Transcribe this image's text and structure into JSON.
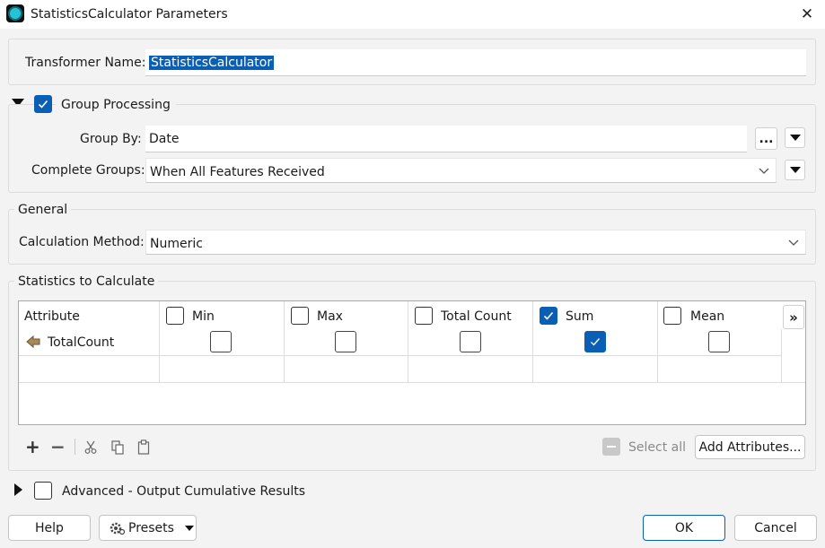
{
  "window": {
    "title": "StatisticsCalculator Parameters"
  },
  "transformer": {
    "label": "Transformer Name:",
    "value": "StatisticsCalculator"
  },
  "group_processing": {
    "label": "Group Processing",
    "checked": true,
    "group_by": {
      "label": "Group By:",
      "value": "Date",
      "browse_label": "..."
    },
    "complete_groups": {
      "label": "Complete Groups:",
      "value": "When All Features Received"
    }
  },
  "general": {
    "label": "General",
    "calc_method": {
      "label": "Calculation Method:",
      "value": "Numeric"
    }
  },
  "stats": {
    "label": "Statistics to Calculate",
    "attribute_header": "Attribute",
    "more_label": "»",
    "columns": [
      {
        "label": "Min",
        "header_checked": false,
        "row_checked": false
      },
      {
        "label": "Max",
        "header_checked": false,
        "row_checked": false
      },
      {
        "label": "Total Count",
        "header_checked": false,
        "row_checked": false
      },
      {
        "label": "Sum",
        "header_checked": true,
        "row_checked": true
      },
      {
        "label": "Mean",
        "header_checked": false,
        "row_checked": false
      }
    ],
    "rows": [
      {
        "attribute": "TotalCount"
      }
    ],
    "toolbar": {
      "select_all_label": "Select all",
      "add_attributes_label": "Add Attributes..."
    }
  },
  "advanced": {
    "label": "Advanced - Output Cumulative Results",
    "checked": false
  },
  "footer": {
    "help_label": "Help",
    "presets_label": "Presets",
    "ok_label": "OK",
    "cancel_label": "Cancel"
  },
  "colors": {
    "accent": "#0a5fb4",
    "selection": "#0a5fb4",
    "background": "#f3f3f3"
  }
}
